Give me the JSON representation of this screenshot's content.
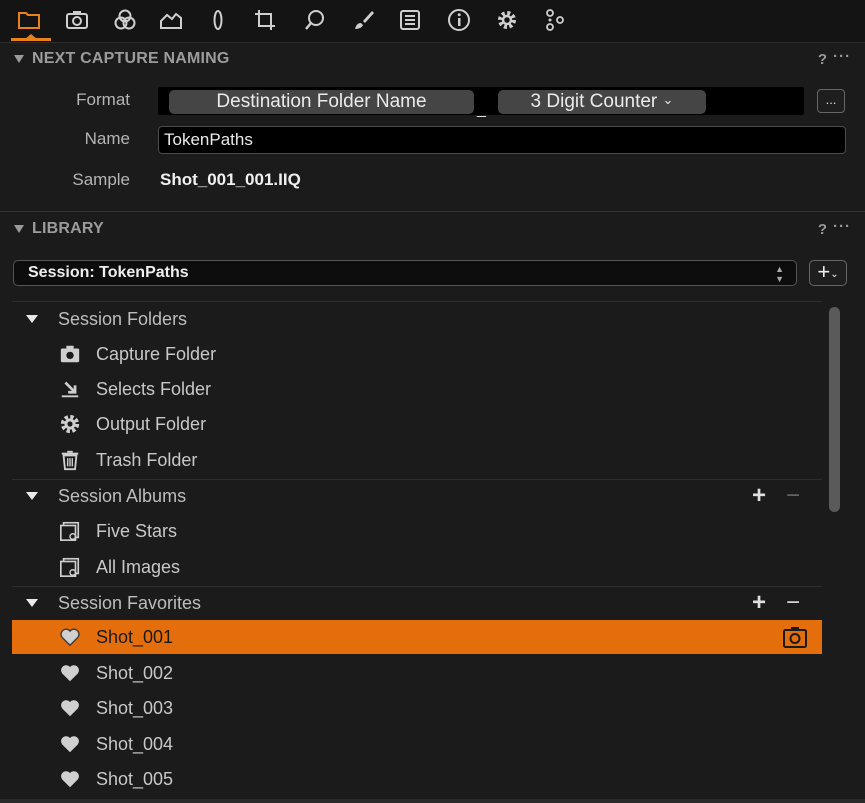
{
  "toolbar": {
    "icons": [
      "folder-icon",
      "camera-icon",
      "color-circles-icon",
      "exposure-icon",
      "lens-icon",
      "crop-icon",
      "search-icon",
      "brush-icon",
      "list-icon",
      "info-icon",
      "gear-icon",
      "nodes-icon"
    ],
    "active": "folder-icon",
    "accent": "#e8801d"
  },
  "naming": {
    "title": "NEXT CAPTURE NAMING",
    "help": "?",
    "more": "···",
    "format_label": "Format",
    "tokens": [
      "Destination Folder Name",
      "3 Digit Counter"
    ],
    "token_separator": "_",
    "token_dropdown": "⌄",
    "dots_label": "...",
    "name_label": "Name",
    "name_value": "TokenPaths",
    "sample_label": "Sample",
    "sample_value": "Shot_001_001.IIQ"
  },
  "library": {
    "title": "LIBRARY",
    "help": "?",
    "more": "···",
    "session_select": "Session: TokenPaths",
    "add_label": "+",
    "add_caret": "⌄",
    "folders": {
      "title": "Session Folders",
      "items": [
        {
          "label": "Capture Folder",
          "icon": "camera-icon"
        },
        {
          "label": "Selects Folder",
          "icon": "selects-icon"
        },
        {
          "label": "Output Folder",
          "icon": "gear-icon"
        },
        {
          "label": "Trash Folder",
          "icon": "trash-icon"
        }
      ]
    },
    "albums": {
      "title": "Session Albums",
      "plus": "+",
      "minus": "−",
      "items": [
        {
          "label": "Five Stars",
          "icon": "smart-album-icon"
        },
        {
          "label": "All Images",
          "icon": "smart-album-icon"
        }
      ]
    },
    "favorites": {
      "title": "Session Favorites",
      "plus": "+",
      "minus": "−",
      "selected_color": "#e56e0c",
      "items": [
        {
          "label": "Shot_001",
          "icon": "heart-icon",
          "selected": true
        },
        {
          "label": "Shot_002",
          "icon": "heart-icon"
        },
        {
          "label": "Shot_003",
          "icon": "heart-icon"
        },
        {
          "label": "Shot_004",
          "icon": "heart-icon"
        },
        {
          "label": "Shot_005",
          "icon": "heart-icon"
        }
      ]
    }
  }
}
